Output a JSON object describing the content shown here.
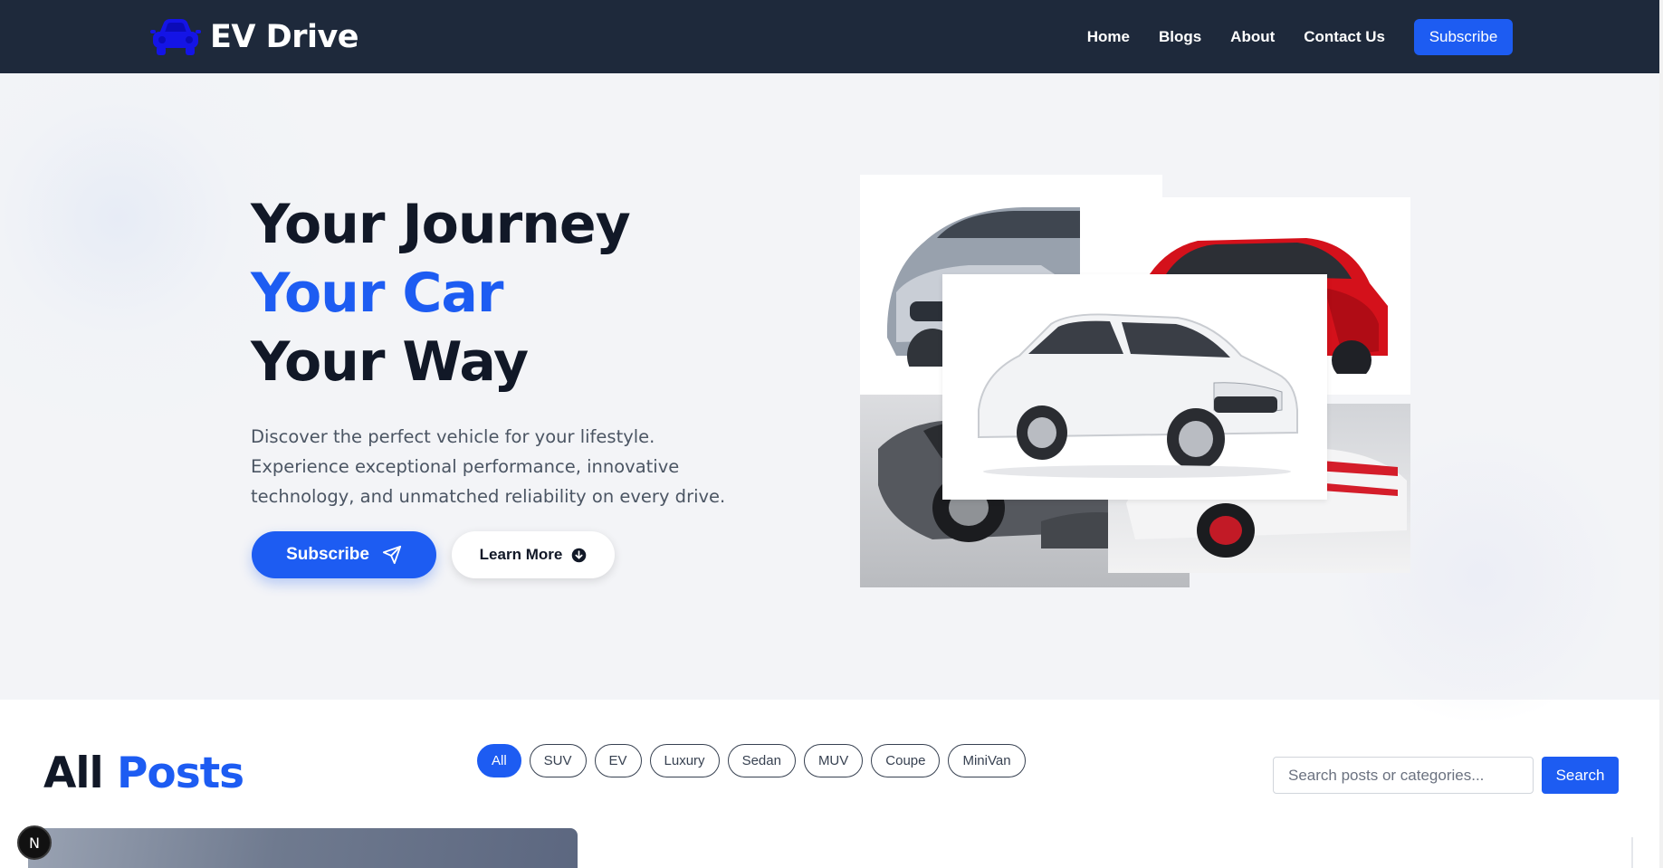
{
  "nav": {
    "brand": "EV Drive",
    "links": [
      "Home",
      "Blogs",
      "About",
      "Contact Us"
    ],
    "subscribe": "Subscribe"
  },
  "hero": {
    "line1": "Your Journey",
    "line2": "Your Car",
    "line3": "Your Way",
    "description": "Discover the perfect vehicle for your lifestyle. Experience exceptional performance, innovative technology, and unmatched reliability on every drive.",
    "subscribe_label": "Subscribe",
    "learn_more_label": "Learn More"
  },
  "posts": {
    "title_part1": "All",
    "title_part2": "Posts",
    "categories": [
      "All",
      "SUV",
      "EV",
      "Luxury",
      "Sedan",
      "MUV",
      "Coupe",
      "MiniVan"
    ],
    "active_category": "All",
    "search_placeholder": "Search posts or categories...",
    "search_button": "Search"
  },
  "badge": {
    "letter": "N"
  },
  "colors": {
    "nav_bg": "#1e293b",
    "accent": "#1d5cf2",
    "hero_bg": "#f3f4f7",
    "text_dark": "#111827",
    "text_muted": "#4b5563"
  },
  "icons": [
    "car-logo-icon",
    "send-icon",
    "arrow-down-circle-icon"
  ]
}
